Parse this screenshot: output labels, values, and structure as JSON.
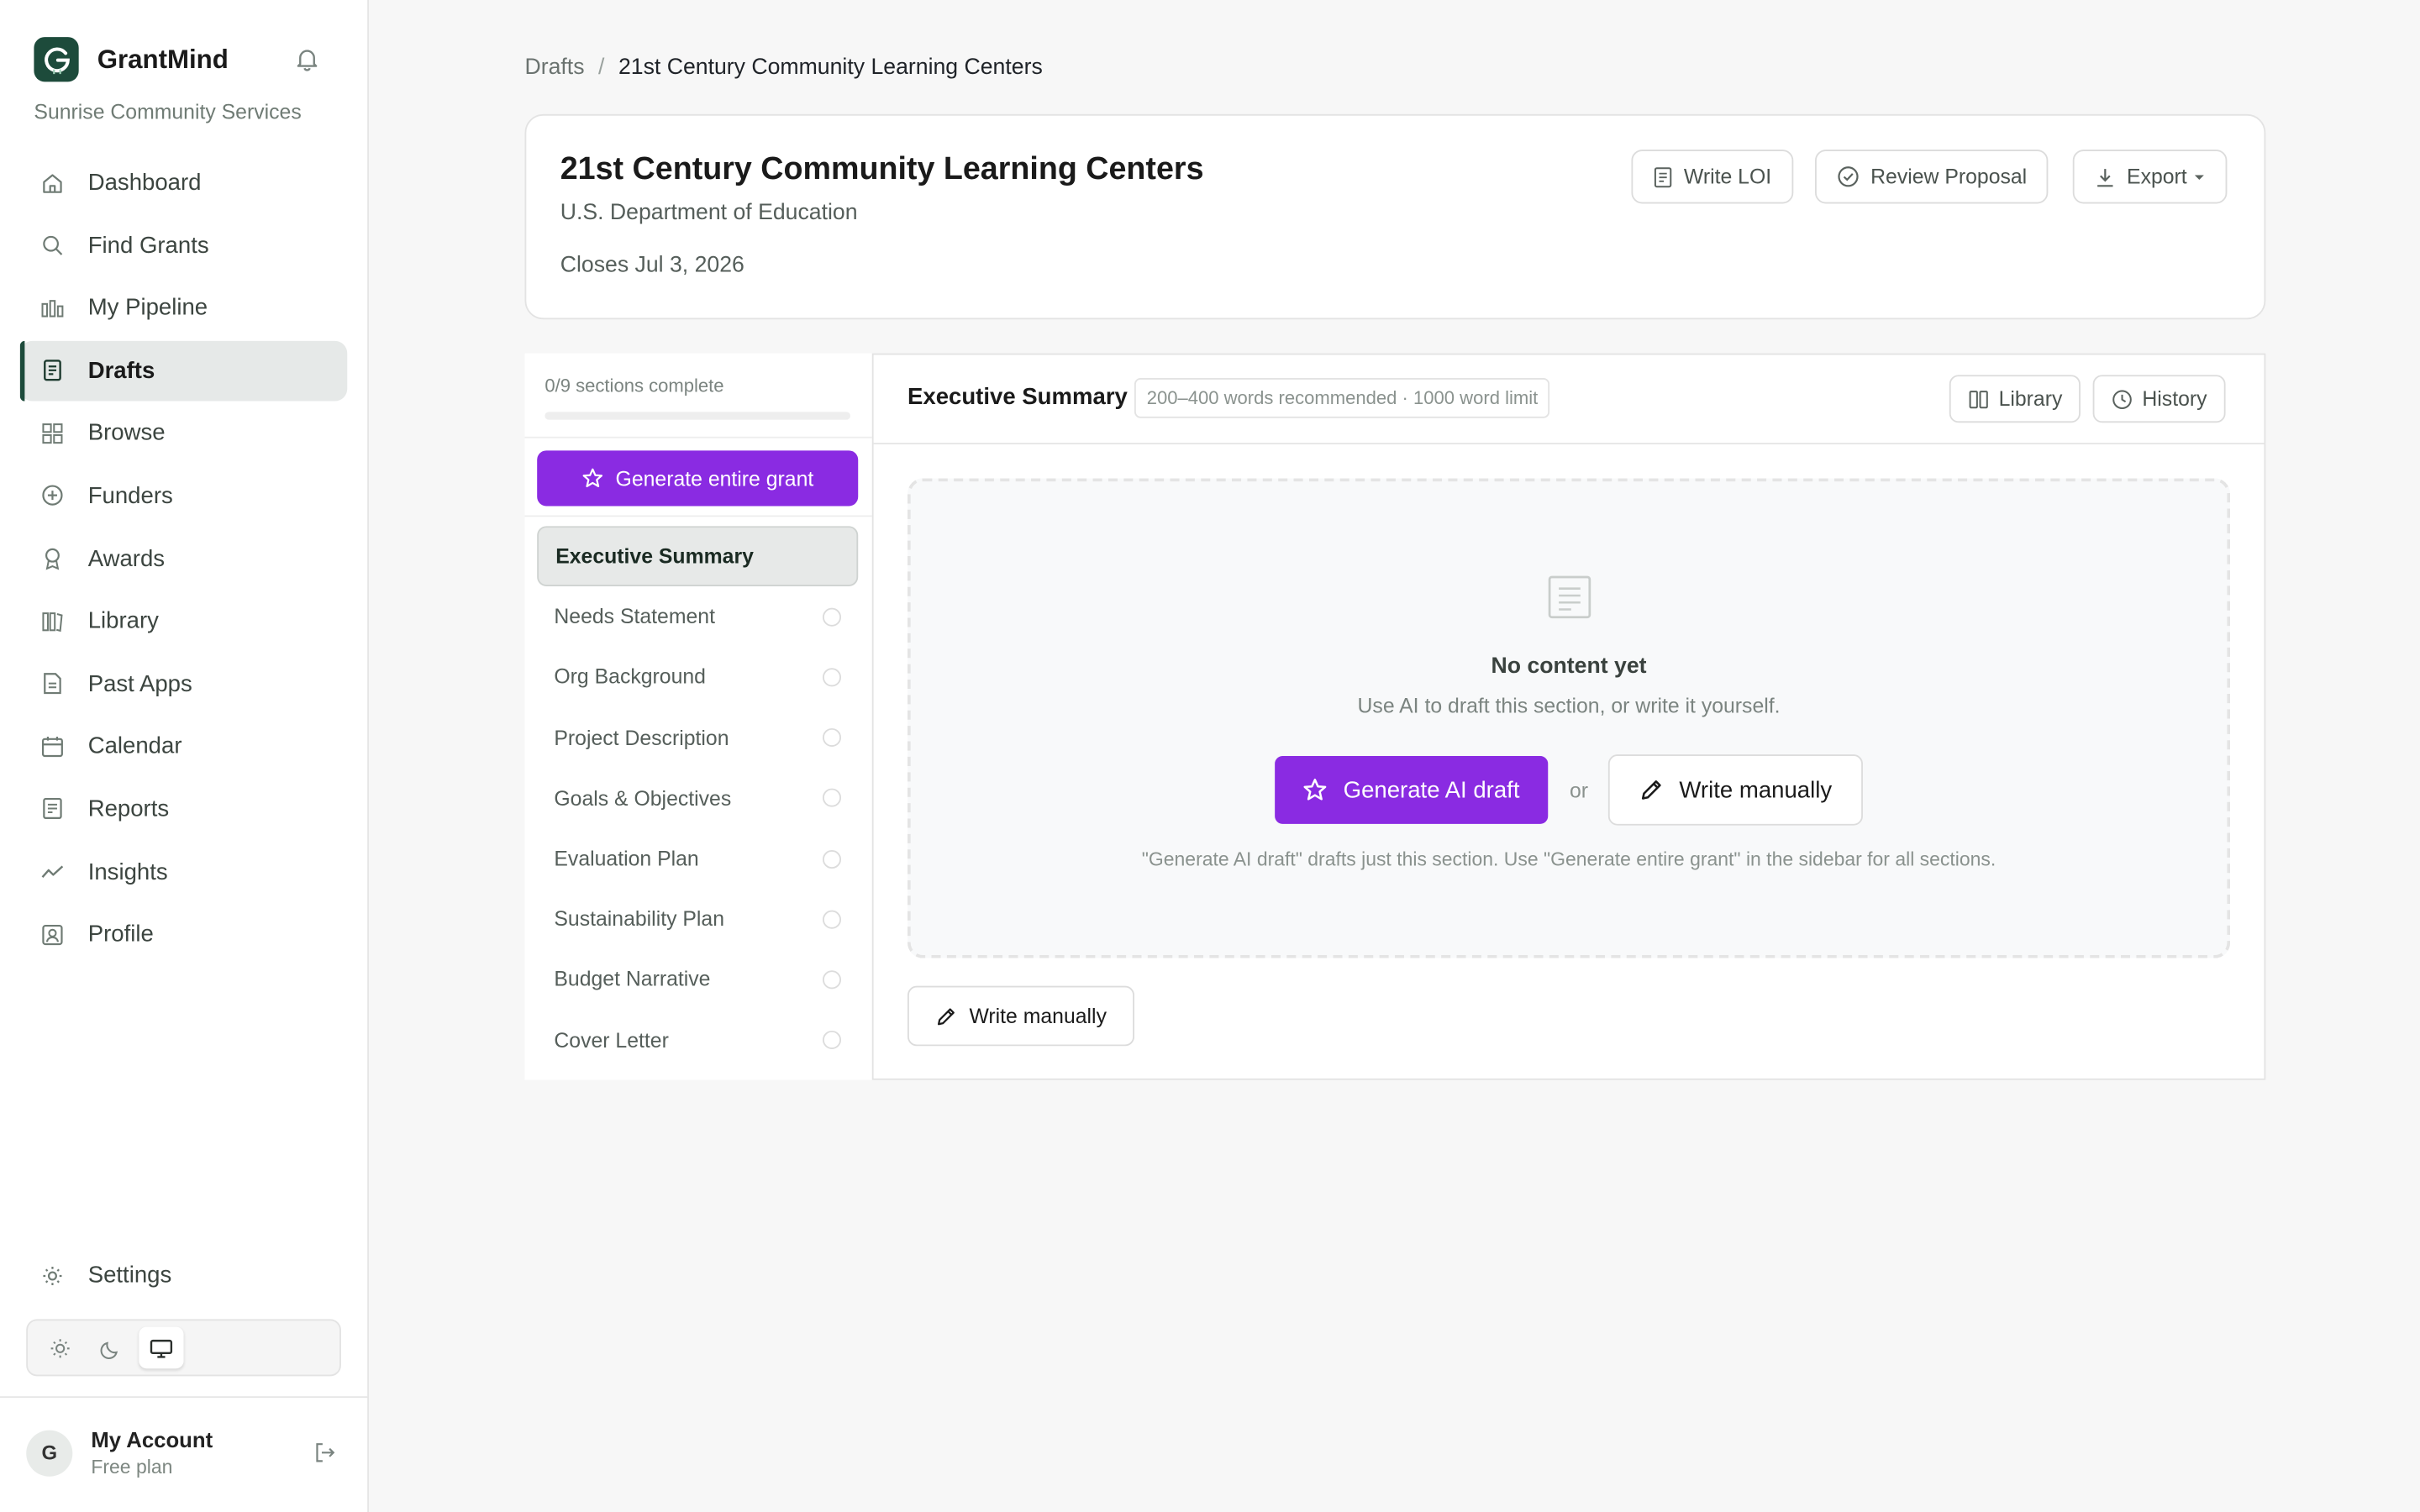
{
  "app": {
    "name": "GrantMind",
    "org": "Sunrise Community Services"
  },
  "nav": {
    "items": [
      {
        "label": "Dashboard",
        "icon": "home-icon"
      },
      {
        "label": "Find Grants",
        "icon": "search-icon"
      },
      {
        "label": "My Pipeline",
        "icon": "pipeline-icon"
      },
      {
        "label": "Drafts",
        "icon": "document-icon",
        "active": true
      },
      {
        "label": "Browse",
        "icon": "grid-icon"
      },
      {
        "label": "Funders",
        "icon": "plus-circle-icon"
      },
      {
        "label": "Awards",
        "icon": "award-icon"
      },
      {
        "label": "Library",
        "icon": "library-icon"
      },
      {
        "label": "Past Apps",
        "icon": "file-icon"
      },
      {
        "label": "Calendar",
        "icon": "calendar-icon"
      },
      {
        "label": "Reports",
        "icon": "report-icon"
      },
      {
        "label": "Insights",
        "icon": "trend-icon"
      },
      {
        "label": "Profile",
        "icon": "profile-icon"
      }
    ],
    "settings": "Settings"
  },
  "theme": {
    "options": [
      "light",
      "dark",
      "system"
    ],
    "selected": "system"
  },
  "account": {
    "name": "My Account",
    "plan": "Free plan",
    "initial": "G"
  },
  "breadcrumb": {
    "parent": "Drafts",
    "separator": "/",
    "current": "21st Century Community Learning Centers"
  },
  "grant": {
    "title": "21st Century Community Learning Centers",
    "agency": "U.S. Department of Education",
    "closes": "Closes Jul 3, 2026",
    "actions": {
      "write_loi": "Write LOI",
      "review": "Review Proposal",
      "export": "Export"
    }
  },
  "sections": {
    "progress_label": "0/9 sections complete",
    "progress": 0,
    "generate_all": "Generate entire grant",
    "items": [
      {
        "label": "Executive Summary",
        "active": true
      },
      {
        "label": "Needs Statement"
      },
      {
        "label": "Org Background"
      },
      {
        "label": "Project Description"
      },
      {
        "label": "Goals & Objectives"
      },
      {
        "label": "Evaluation Plan"
      },
      {
        "label": "Sustainability Plan"
      },
      {
        "label": "Budget Narrative"
      },
      {
        "label": "Cover Letter"
      }
    ]
  },
  "editor": {
    "title": "Executive Summary",
    "limit": "200–400 words recommended · 1000 word limit",
    "library": "Library",
    "history": "History",
    "empty_title": "No content yet",
    "empty_sub": "Use AI to draft this section, or write it yourself.",
    "generate_ai": "Generate AI draft",
    "or": "or",
    "write_manually": "Write manually",
    "hint": "\"Generate AI draft\" drafts just this section. Use \"Generate entire grant\" in the sidebar for all sections.",
    "write_manually_bottom": "Write manually"
  },
  "colors": {
    "brand": "#1d4b3b",
    "accent": "#8a2be2"
  }
}
